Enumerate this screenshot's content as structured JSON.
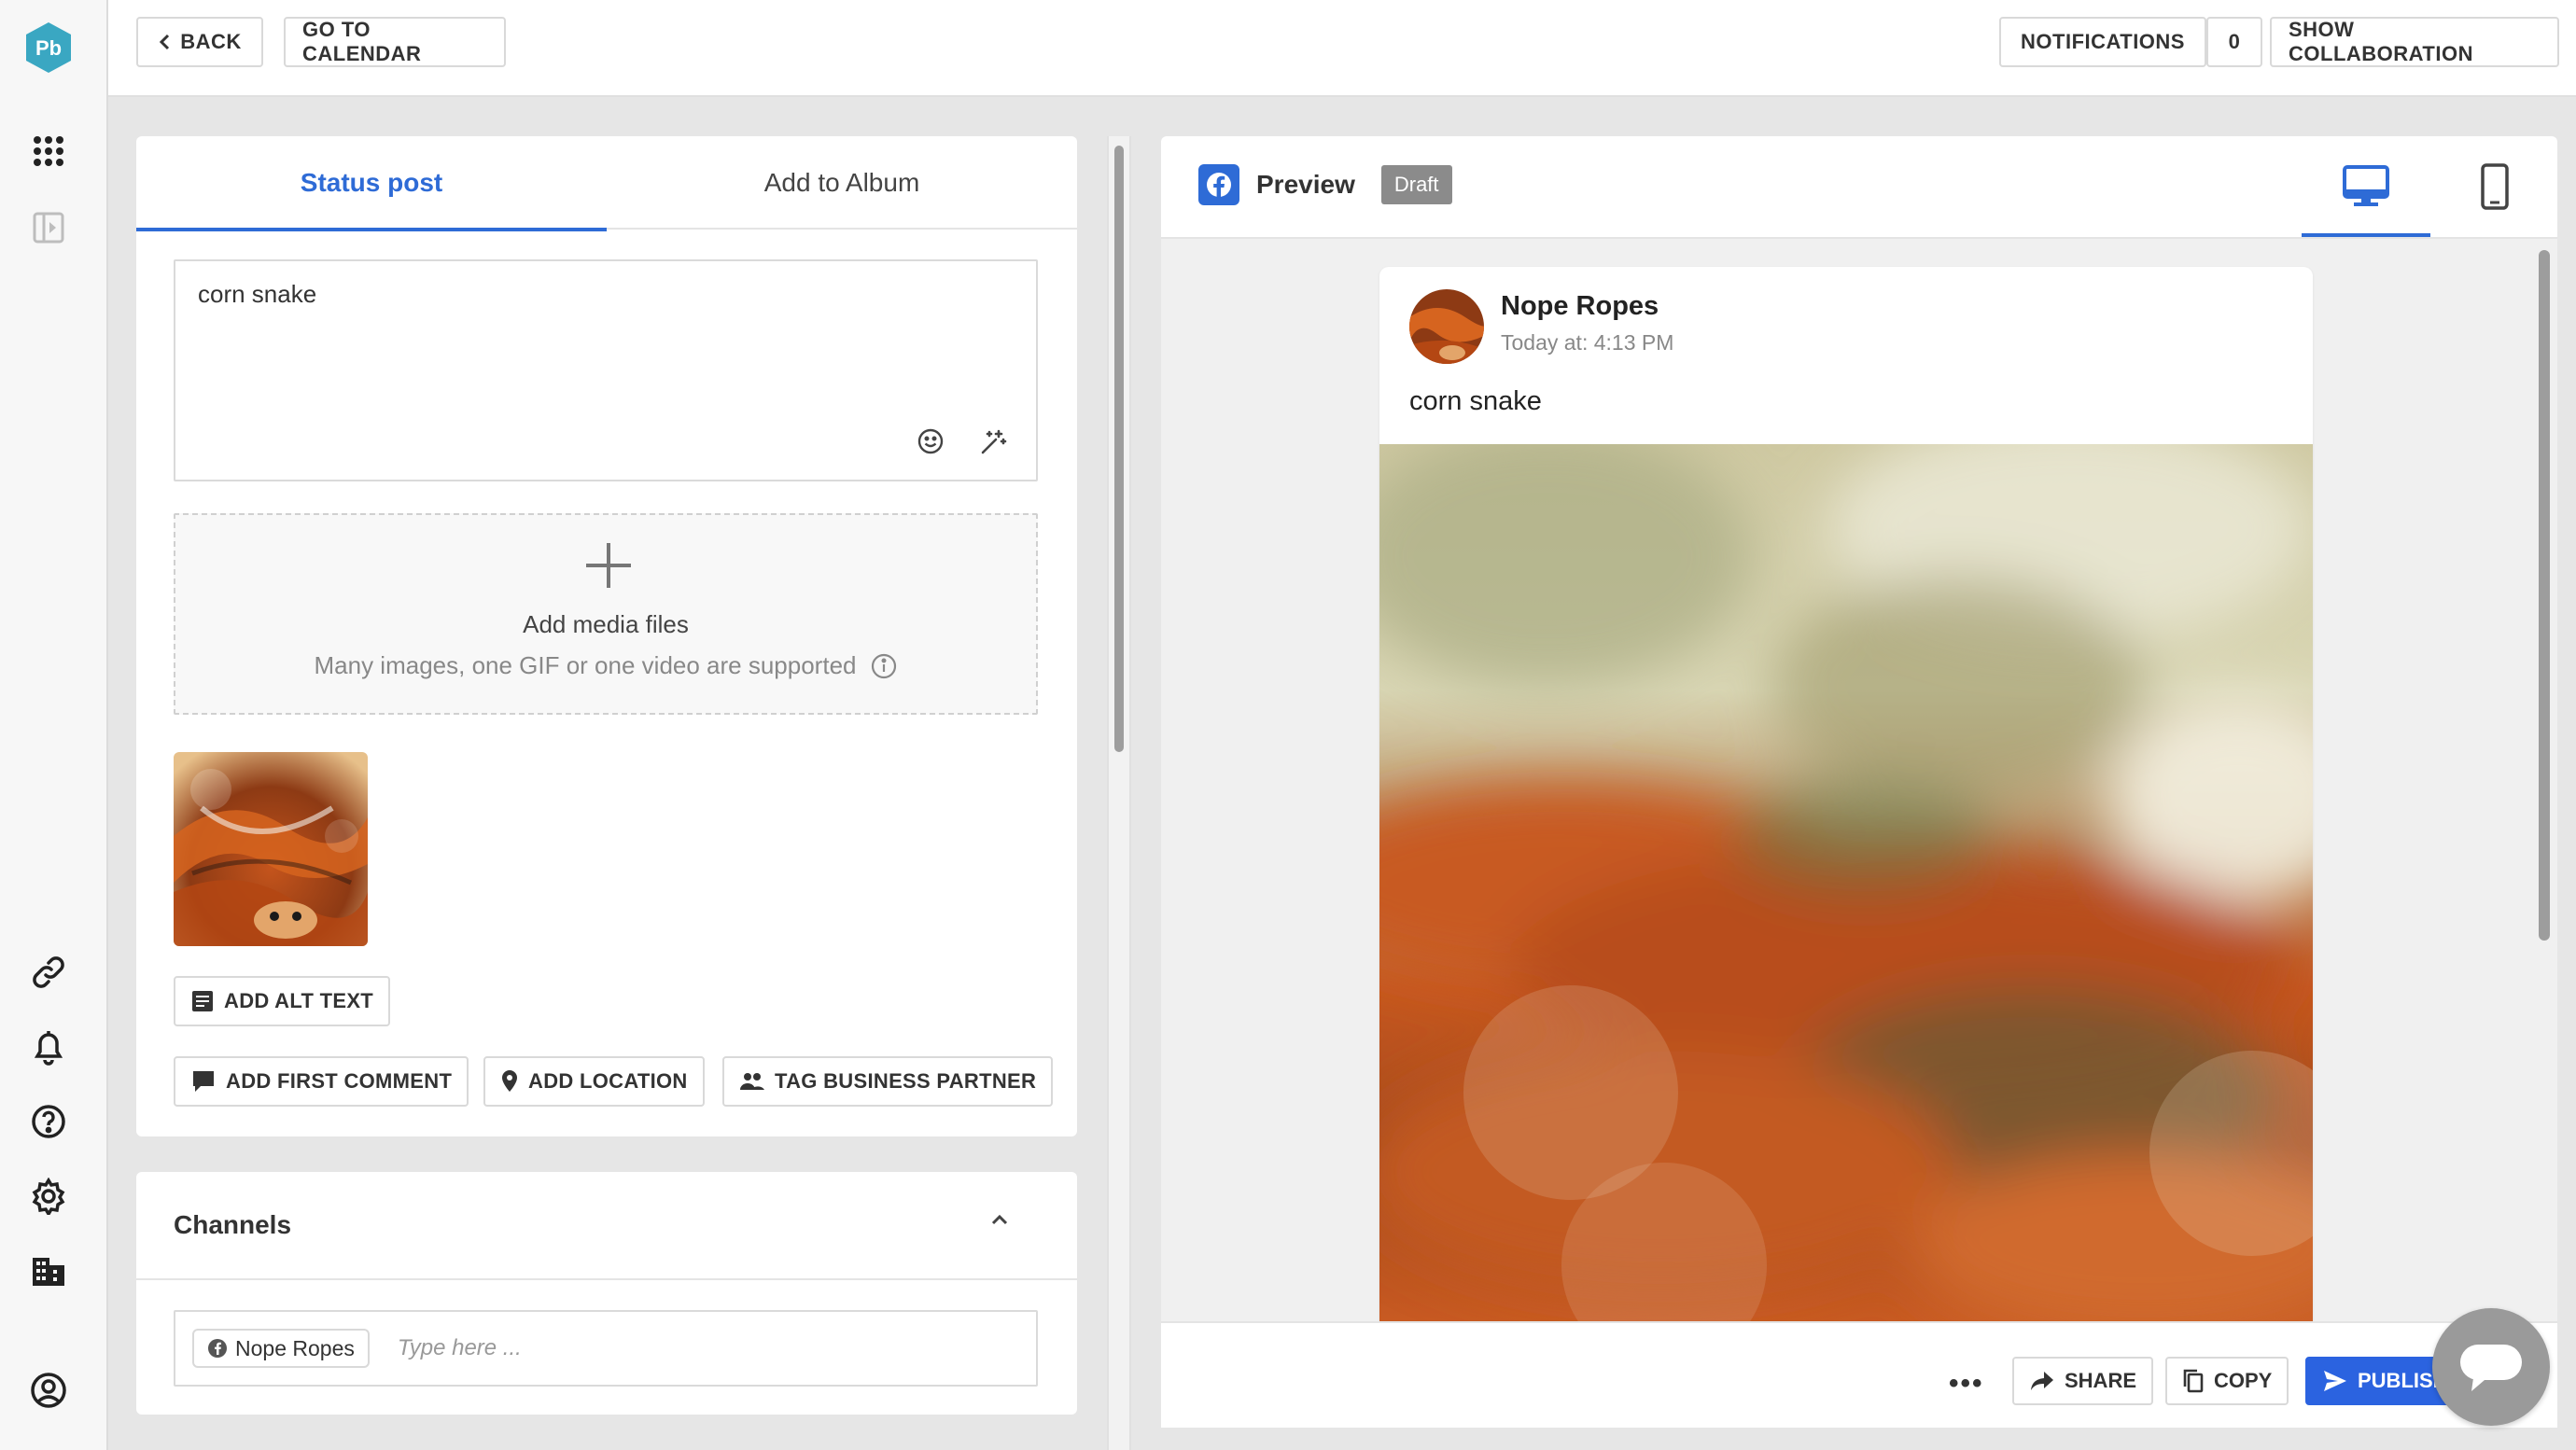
{
  "app": {
    "logo_text": "Pb",
    "brand_color": "#3aa7c2"
  },
  "topbar": {
    "back_label": "BACK",
    "calendar_label": "GO TO CALENDAR",
    "notifications_label": "NOTIFICATIONS",
    "notifications_count": "0",
    "collab_label": "SHOW COLLABORATION"
  },
  "editor": {
    "tabs": [
      {
        "label": "Status post",
        "active": true
      },
      {
        "label": "Add to Album",
        "active": false
      }
    ],
    "text_value": "corn snake",
    "dropzone_title": "Add media files",
    "dropzone_hint": "Many images, one GIF or one video are supported",
    "alt_text_label": "ADD ALT TEXT",
    "first_comment_label": "ADD FIRST COMMENT",
    "location_label": "ADD LOCATION",
    "partner_label": "TAG BUSINESS PARTNER"
  },
  "channels": {
    "title": "Channels",
    "chip_label": "Nope Ropes",
    "placeholder": "Type here ..."
  },
  "preview": {
    "title": "Preview",
    "status_badge": "Draft",
    "post": {
      "author": "Nope Ropes",
      "time": "Today at: 4:13 PM",
      "message": "corn snake"
    },
    "actions": {
      "more": "•••",
      "share_label": "SHARE",
      "copy_label": "COPY",
      "publish_label": "PUBLISH"
    },
    "accent_color": "#2e6bd6"
  }
}
